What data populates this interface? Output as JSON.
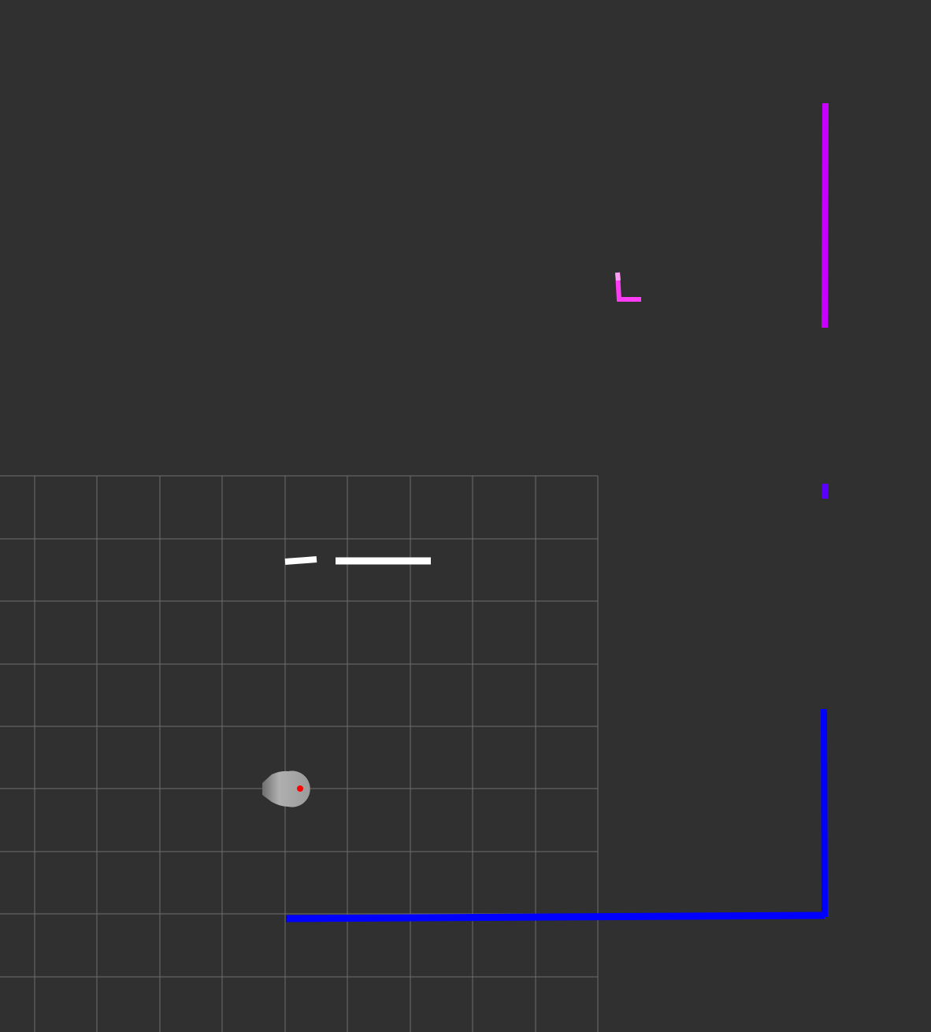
{
  "viewport": {
    "background": "#303030"
  },
  "grid": {
    "visible": true,
    "color": "#6e6e6e"
  },
  "robot": {
    "body_color": "#9a9a9a",
    "indicator_color": "#ff0000"
  },
  "scan_segments": {
    "white_color": "#ffffff",
    "magenta_color": "#ff3cf5",
    "violet_color": "#c800ff",
    "indigo_color": "#5a00ff",
    "blue_color": "#0000ff"
  }
}
